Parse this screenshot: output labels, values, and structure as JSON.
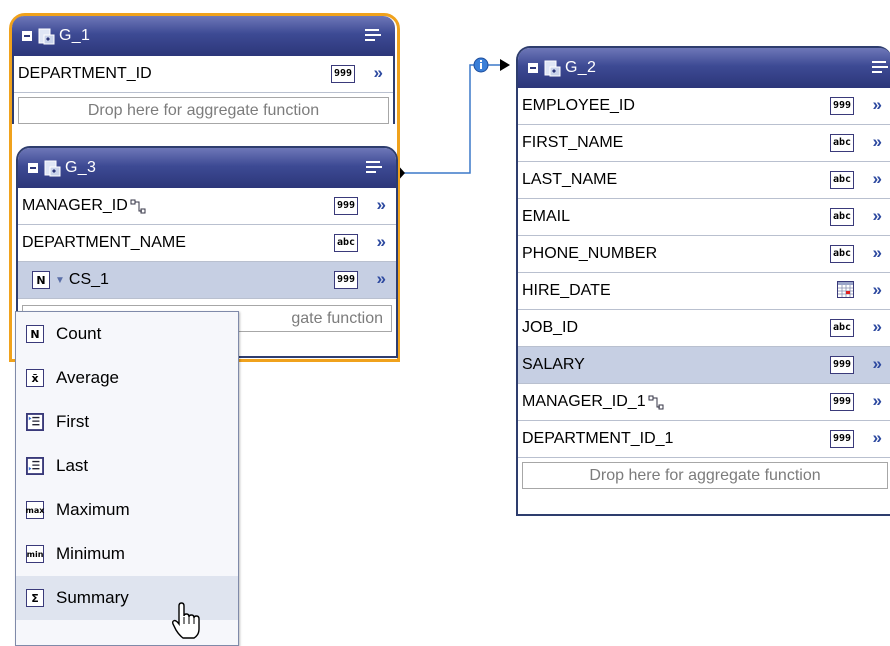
{
  "groups": {
    "g1": {
      "name": "G_1",
      "rows": [
        {
          "field": "DEPARTMENT_ID",
          "type": "999"
        }
      ],
      "drop_text": "Drop here for aggregate function"
    },
    "g3": {
      "name": "G_3",
      "rows": [
        {
          "field": "MANAGER_ID",
          "type": "999"
        },
        {
          "field": "DEPARTMENT_NAME",
          "type": "abc"
        },
        {
          "field": "CS_1",
          "type": "999",
          "agg_badge": "N"
        }
      ],
      "drop_text_partial": "gate function"
    },
    "g2": {
      "name": "G_2",
      "rows": [
        {
          "field": "EMPLOYEE_ID",
          "type": "999"
        },
        {
          "field": "FIRST_NAME",
          "type": "abc"
        },
        {
          "field": "LAST_NAME",
          "type": "abc"
        },
        {
          "field": "EMAIL",
          "type": "abc"
        },
        {
          "field": "PHONE_NUMBER",
          "type": "abc"
        },
        {
          "field": "HIRE_DATE",
          "type": "date"
        },
        {
          "field": "JOB_ID",
          "type": "abc"
        },
        {
          "field": "SALARY",
          "type": "999"
        },
        {
          "field": "MANAGER_ID_1",
          "type": "999"
        },
        {
          "field": "DEPARTMENT_ID_1",
          "type": "999"
        }
      ],
      "drop_text": "Drop here for aggregate function"
    }
  },
  "aggregate_menu": {
    "items": [
      {
        "label": "Count",
        "icon": "N"
      },
      {
        "label": "Average",
        "icon": "x̄"
      },
      {
        "label": "First",
        "icon": "first-icon"
      },
      {
        "label": "Last",
        "icon": "last-icon"
      },
      {
        "label": "Maximum",
        "icon": "max"
      },
      {
        "label": "Minimum",
        "icon": "min"
      },
      {
        "label": "Summary",
        "icon": "Σ"
      }
    ]
  },
  "chevron": "»",
  "colors": {
    "header": "#3d4a94",
    "selected_row": "#c6cfe3",
    "focus_border": "#f0a21c",
    "link_line": "#3c78c8"
  }
}
